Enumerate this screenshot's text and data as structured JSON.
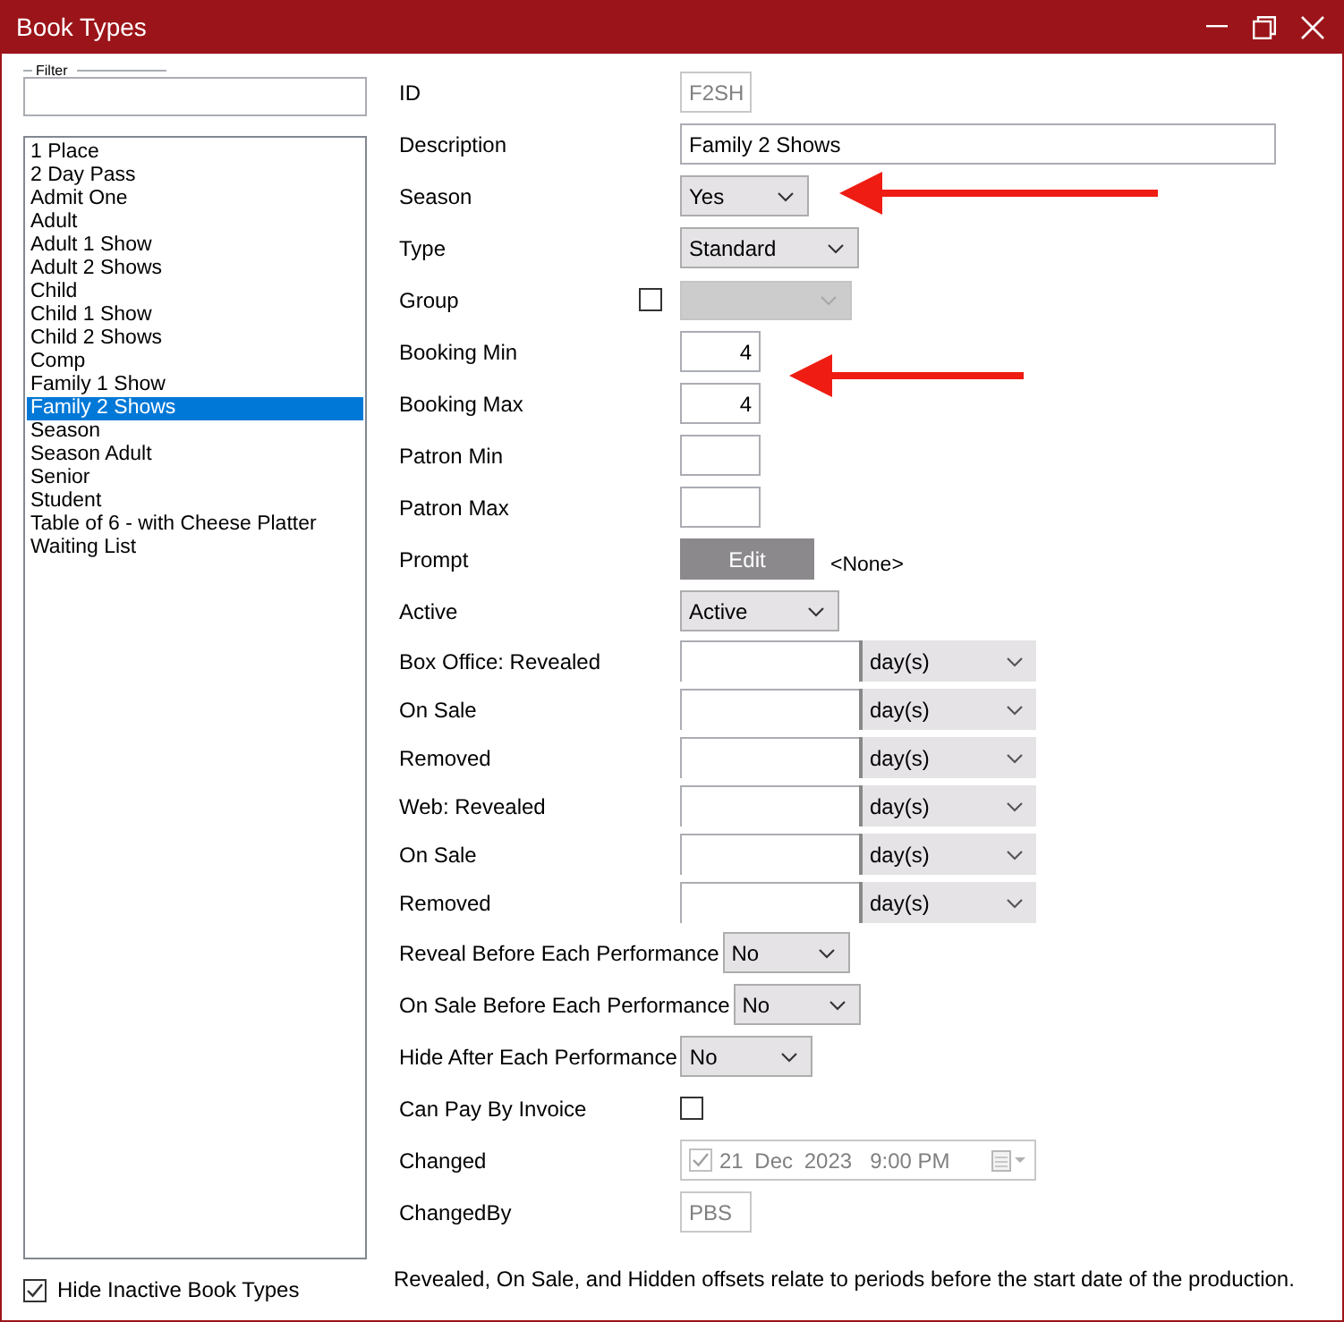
{
  "window": {
    "title": "Book Types"
  },
  "filter": {
    "label": "Filter"
  },
  "book_types": [
    {
      "label": "1 Place",
      "selected": false
    },
    {
      "label": "2 Day Pass",
      "selected": false
    },
    {
      "label": "Admit One",
      "selected": false
    },
    {
      "label": "Adult",
      "selected": false
    },
    {
      "label": "Adult 1 Show",
      "selected": false
    },
    {
      "label": "Adult 2 Shows",
      "selected": false
    },
    {
      "label": "Child",
      "selected": false
    },
    {
      "label": "Child 1 Show",
      "selected": false
    },
    {
      "label": "Child 2 Shows",
      "selected": false
    },
    {
      "label": "Comp",
      "selected": false
    },
    {
      "label": "Family 1 Show",
      "selected": false
    },
    {
      "label": "Family 2 Shows",
      "selected": true
    },
    {
      "label": "Season",
      "selected": false
    },
    {
      "label": "Season Adult",
      "selected": false
    },
    {
      "label": "Senior",
      "selected": false
    },
    {
      "label": "Student",
      "selected": false
    },
    {
      "label": "Table of 6 - with Cheese Platter",
      "selected": false
    },
    {
      "label": "Waiting List",
      "selected": false
    }
  ],
  "hide_inactive": {
    "label": "Hide Inactive Book Types",
    "checked": true
  },
  "fields": [
    {
      "kind": "text",
      "label": "ID",
      "value": "F2SH",
      "disabled": true
    },
    {
      "kind": "text",
      "label": "Description",
      "value": "Family 2 Shows",
      "disabled": false
    },
    {
      "kind": "select",
      "label": "Season",
      "value": "Yes"
    },
    {
      "kind": "select",
      "label": "Type",
      "value": "Standard"
    },
    {
      "kind": "check-select",
      "label": "Group",
      "checked": false,
      "disabled": true
    },
    {
      "kind": "number",
      "label": "Booking Min",
      "value": "4"
    },
    {
      "kind": "number",
      "label": "Booking Max",
      "value": "4"
    },
    {
      "kind": "number",
      "label": "Patron Min"
    },
    {
      "kind": "number",
      "label": "Patron Max"
    },
    {
      "kind": "button",
      "label": "Prompt",
      "button": "Edit",
      "value": "<None>"
    },
    {
      "kind": "select",
      "label": "Active",
      "value": "Active"
    },
    {
      "kind": "offset",
      "label": "Box Office: Revealed",
      "unit": "day(s)"
    },
    {
      "kind": "offset",
      "label": "On Sale",
      "unit": "day(s)"
    },
    {
      "kind": "offset",
      "label": "Removed",
      "unit": "day(s)"
    },
    {
      "kind": "offset",
      "label": "Web: Revealed",
      "unit": "day(s)"
    },
    {
      "kind": "offset",
      "label": "On Sale",
      "unit": "day(s)"
    },
    {
      "kind": "offset",
      "label": "Removed",
      "unit": "day(s)"
    },
    {
      "kind": "inline-select",
      "label": "Reveal Before Each Performance",
      "value": "No"
    },
    {
      "kind": "inline-select",
      "label": "On Sale Before Each Performance",
      "value": "No"
    },
    {
      "kind": "inline-select",
      "label": "Hide After Each Performance",
      "value": "No"
    },
    {
      "kind": "checkbox",
      "label": "Can Pay By Invoice",
      "checked": false
    },
    {
      "kind": "datetime",
      "label": "Changed",
      "checked": true,
      "date": "21 Dec 2023",
      "time": "9:00 PM",
      "disabled": true
    },
    {
      "kind": "text",
      "label": "ChangedBy",
      "value": "PBS",
      "disabled": true
    }
  ],
  "note": "Revealed, On Sale, and Hidden offsets relate to periods before the start date of the production."
}
